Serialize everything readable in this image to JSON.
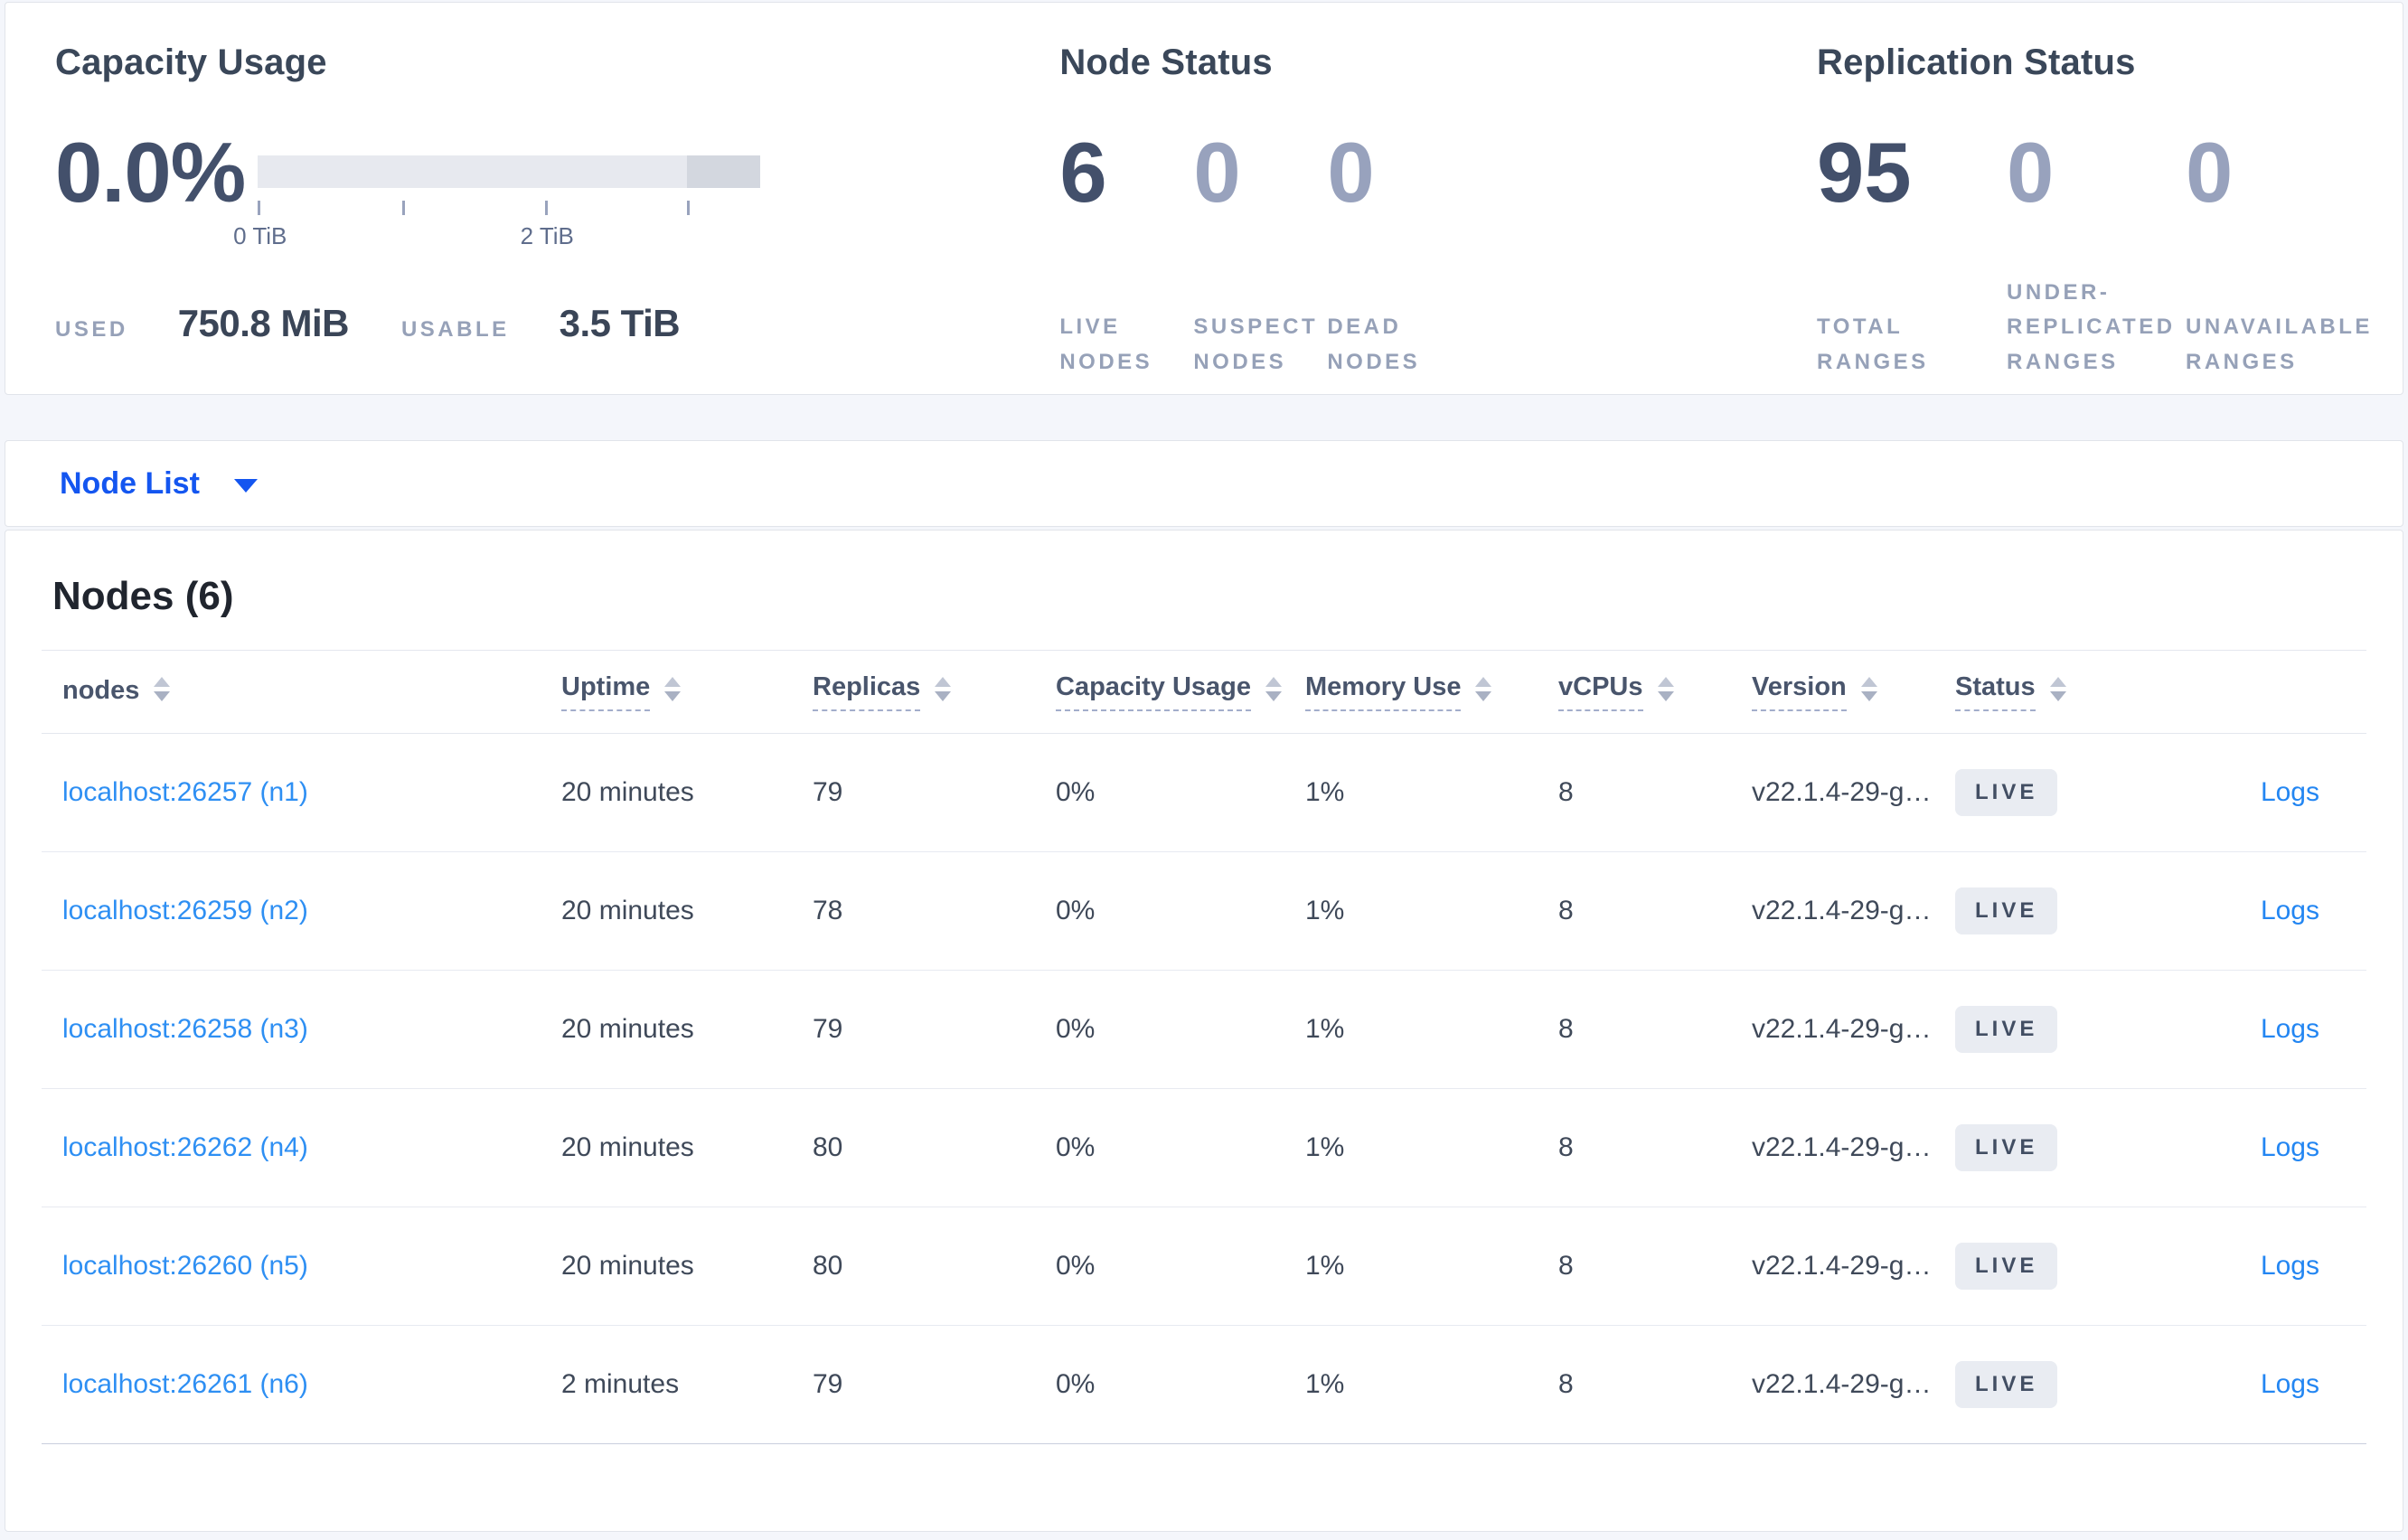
{
  "colors": {
    "page_background": "#f4f6fb",
    "accent_blue": "#1456f0",
    "node_link_blue": "#2e8ff3",
    "logs_link_blue": "#2386f2",
    "stat_primary": "#43506b",
    "stat_muted": "#98a2bd",
    "label_gray": "#96a1b8",
    "badge_bg": "#e9ecf2",
    "badge_text": "#424e63",
    "bar_track": "#e7e9ef",
    "bar_segment": "#d3d7df"
  },
  "capacity_panel": {
    "title": "Capacity Usage",
    "percent": "0.0%",
    "bar": {
      "tick_labels": [
        "0 TiB",
        "2 TiB"
      ]
    },
    "used_label": "USED",
    "used_value": "750.8 MiB",
    "usable_label": "USABLE",
    "usable_value": "3.5 TiB"
  },
  "node_status_panel": {
    "title": "Node Status",
    "stats": [
      {
        "value": "6",
        "label": "LIVE NODES"
      },
      {
        "value": "0",
        "label": "SUSPECT NODES"
      },
      {
        "value": "0",
        "label": "DEAD NODES"
      }
    ]
  },
  "replication_panel": {
    "title": "Replication Status",
    "stats": [
      {
        "value": "95",
        "label": "TOTAL RANGES"
      },
      {
        "value": "0",
        "label": "UNDER-REPLICATED RANGES"
      },
      {
        "value": "0",
        "label": "UNAVAILABLE RANGES"
      }
    ]
  },
  "node_list_bar": {
    "label": "Node List",
    "icon": "caret-down-icon"
  },
  "nodes_section": {
    "heading": "Nodes (6)",
    "logs_label": "Logs",
    "columns": [
      {
        "label": "nodes"
      },
      {
        "label": "Uptime"
      },
      {
        "label": "Replicas"
      },
      {
        "label": "Capacity Usage"
      },
      {
        "label": "Memory Use"
      },
      {
        "label": "vCPUs"
      },
      {
        "label": "Version"
      },
      {
        "label": "Status"
      }
    ],
    "rows": [
      {
        "node": "localhost:26257 (n1)",
        "uptime": "20 minutes",
        "replicas": "79",
        "capacity_usage": "0%",
        "memory_use": "1%",
        "vcpus": "8",
        "version": "v22.1.4-29-g…",
        "status": "LIVE"
      },
      {
        "node": "localhost:26259 (n2)",
        "uptime": "20 minutes",
        "replicas": "78",
        "capacity_usage": "0%",
        "memory_use": "1%",
        "vcpus": "8",
        "version": "v22.1.4-29-g…",
        "status": "LIVE"
      },
      {
        "node": "localhost:26258 (n3)",
        "uptime": "20 minutes",
        "replicas": "79",
        "capacity_usage": "0%",
        "memory_use": "1%",
        "vcpus": "8",
        "version": "v22.1.4-29-g…",
        "status": "LIVE"
      },
      {
        "node": "localhost:26262 (n4)",
        "uptime": "20 minutes",
        "replicas": "80",
        "capacity_usage": "0%",
        "memory_use": "1%",
        "vcpus": "8",
        "version": "v22.1.4-29-g…",
        "status": "LIVE"
      },
      {
        "node": "localhost:26260 (n5)",
        "uptime": "20 minutes",
        "replicas": "80",
        "capacity_usage": "0%",
        "memory_use": "1%",
        "vcpus": "8",
        "version": "v22.1.4-29-g…",
        "status": "LIVE"
      },
      {
        "node": "localhost:26261 (n6)",
        "uptime": "2 minutes",
        "replicas": "79",
        "capacity_usage": "0%",
        "memory_use": "1%",
        "vcpus": "8",
        "version": "v22.1.4-29-g…",
        "status": "LIVE"
      }
    ]
  }
}
